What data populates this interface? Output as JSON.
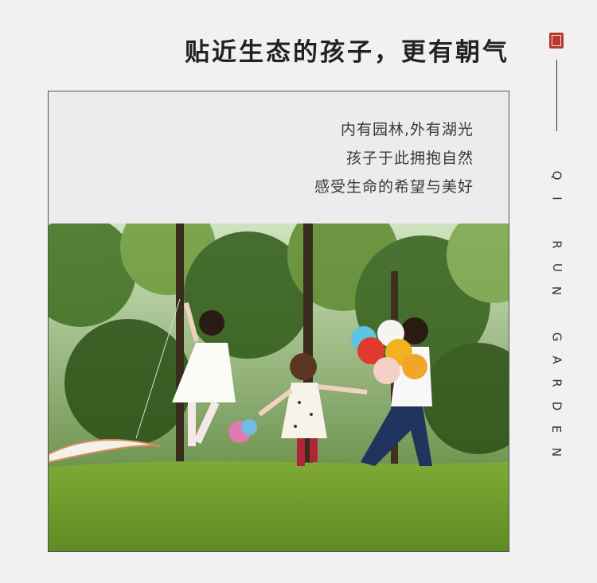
{
  "headline": "贴近生态的孩子，更有朝气",
  "tagline_lines": [
    "内有园林,外有湖光",
    "孩子于此拥抱自然",
    "感受生命的希望与美好"
  ],
  "vertical_letters": {
    "qi": [
      "Q",
      "I"
    ],
    "run": [
      "R",
      "U",
      "N"
    ],
    "garden": [
      "G",
      "A",
      "R",
      "D",
      "E",
      "N"
    ]
  },
  "colors": {
    "background": "#f1f1f1",
    "seal": "#b83a2c",
    "grass": "#6f9a2f"
  }
}
